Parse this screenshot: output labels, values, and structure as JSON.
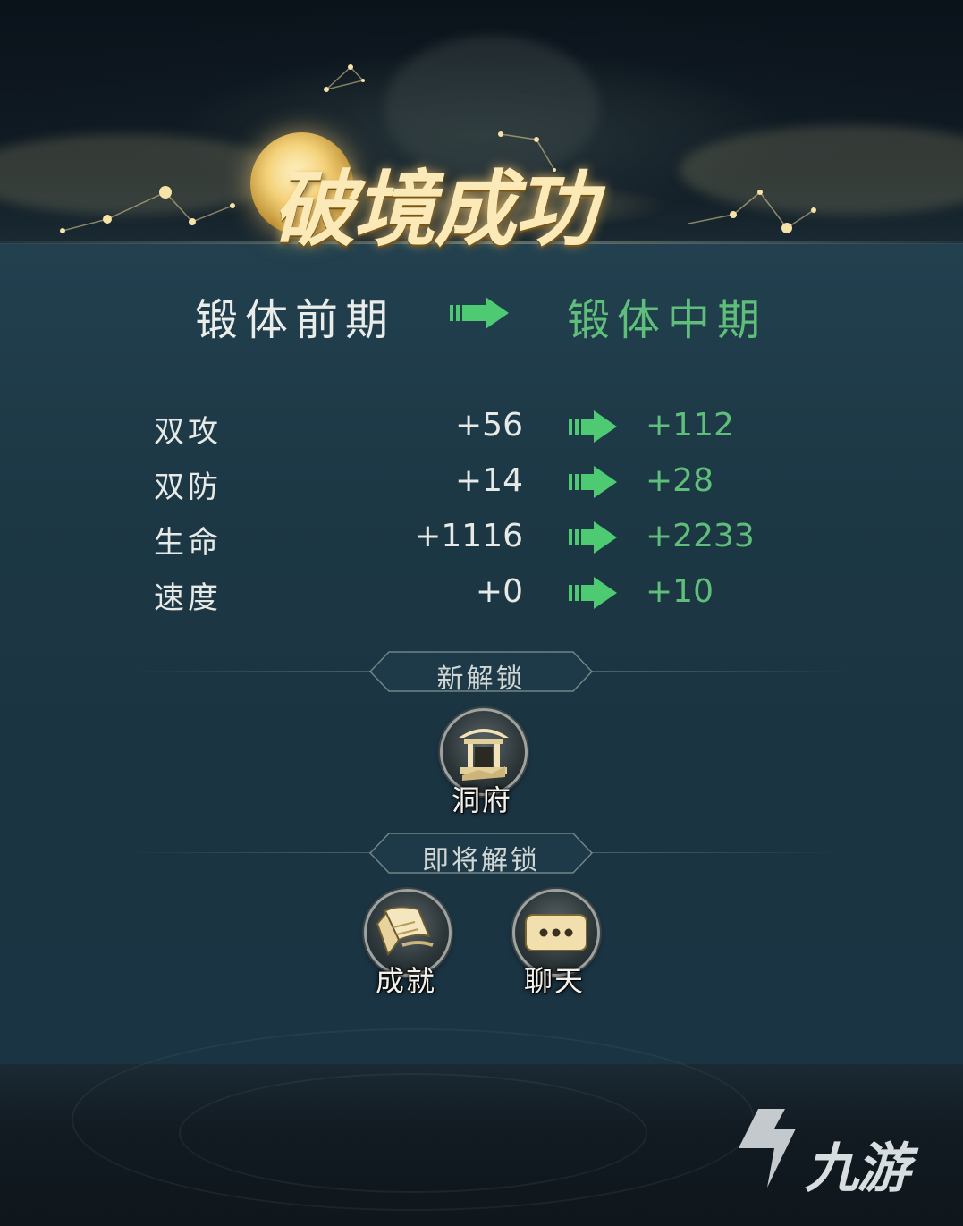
{
  "title": "破境成功",
  "realm": {
    "from": "锻体前期",
    "to": "锻体中期"
  },
  "stats": [
    {
      "label": "双攻",
      "old": "+56",
      "new": "+112"
    },
    {
      "label": "双防",
      "old": "+14",
      "new": "+28"
    },
    {
      "label": "生命",
      "old": "+1116",
      "new": "+2233"
    },
    {
      "label": "速度",
      "old": "+0",
      "new": "+10"
    }
  ],
  "new_unlock": {
    "heading": "新解锁",
    "items": [
      {
        "label": "洞府",
        "icon": "cave-mansion-icon"
      }
    ]
  },
  "upcoming_unlock": {
    "heading": "即将解锁",
    "items": [
      {
        "label": "成就",
        "icon": "scroll-icon"
      },
      {
        "label": "聊天",
        "icon": "chat-bubble-icon"
      }
    ]
  },
  "watermark": "九游",
  "colors": {
    "gain_green": "#5fbf7a",
    "arrow_green": "#4ecb72",
    "gold": "#f4d27a",
    "panel": "#1c3644"
  }
}
